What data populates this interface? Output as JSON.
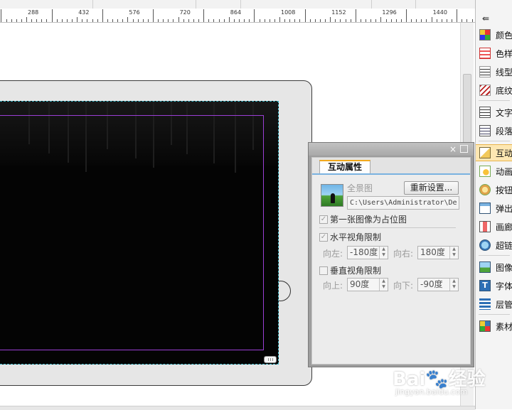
{
  "ruler": {
    "labels": [
      "288",
      "432",
      "576",
      "720",
      "864",
      "1008",
      "1152",
      "1296",
      "1440"
    ]
  },
  "right_panel": {
    "header_icon": "list-indent-icon",
    "items": [
      {
        "label": "颜色",
        "icon": "color-grid-icon"
      },
      {
        "label": "色样",
        "icon": "color-swatch-icon"
      },
      {
        "label": "线型",
        "icon": "line-style-icon"
      },
      {
        "label": "底纹",
        "icon": "hatch-pattern-icon"
      },
      {
        "label": "文字",
        "icon": "text-icon"
      },
      {
        "label": "段落",
        "icon": "paragraph-icon"
      },
      {
        "label": "互动",
        "icon": "interaction-icon",
        "active": true
      },
      {
        "label": "动画",
        "icon": "animation-icon"
      },
      {
        "label": "按钮",
        "icon": "button-icon"
      },
      {
        "label": "弹出",
        "icon": "popup-icon"
      },
      {
        "label": "画廊",
        "icon": "gallery-icon"
      },
      {
        "label": "超链",
        "icon": "hyperlink-icon"
      },
      {
        "label": "图像",
        "icon": "image-icon"
      },
      {
        "label": "字体",
        "icon": "font-icon"
      },
      {
        "label": "层管",
        "icon": "layers-icon"
      },
      {
        "label": "素材",
        "icon": "assets-icon"
      }
    ]
  },
  "float_panel": {
    "close_symbol": "×",
    "tab_label": "互动属性",
    "type_label": "全景图",
    "reset_button": "重新设置...",
    "file_path": "C:\\Users\\Administrator\\De",
    "placeholder_checkbox": {
      "label": "第一张图像为占位图",
      "checked": true
    },
    "horizontal_limit": {
      "label": "水平视角限制",
      "checked": true
    },
    "left_label": "向左:",
    "left_value": "-180度",
    "right_label": "向右:",
    "right_value": "180度",
    "vertical_limit": {
      "label": "垂直视角限制",
      "checked": false
    },
    "up_label": "向上:",
    "up_value": "90度",
    "down_label": "向下:",
    "down_value": "-90度"
  },
  "watermark": {
    "brand": "Bai",
    "brand_suffix": "经验",
    "url": "jingyan.baidu.com"
  },
  "colors": {
    "accent_tab": "#f2a91c",
    "selection_bg": "#fde7b2",
    "guide_purple": "#9b3fd6",
    "bleed_cyan": "#3cb8c8",
    "tab_blue": "#7ab2e0"
  }
}
